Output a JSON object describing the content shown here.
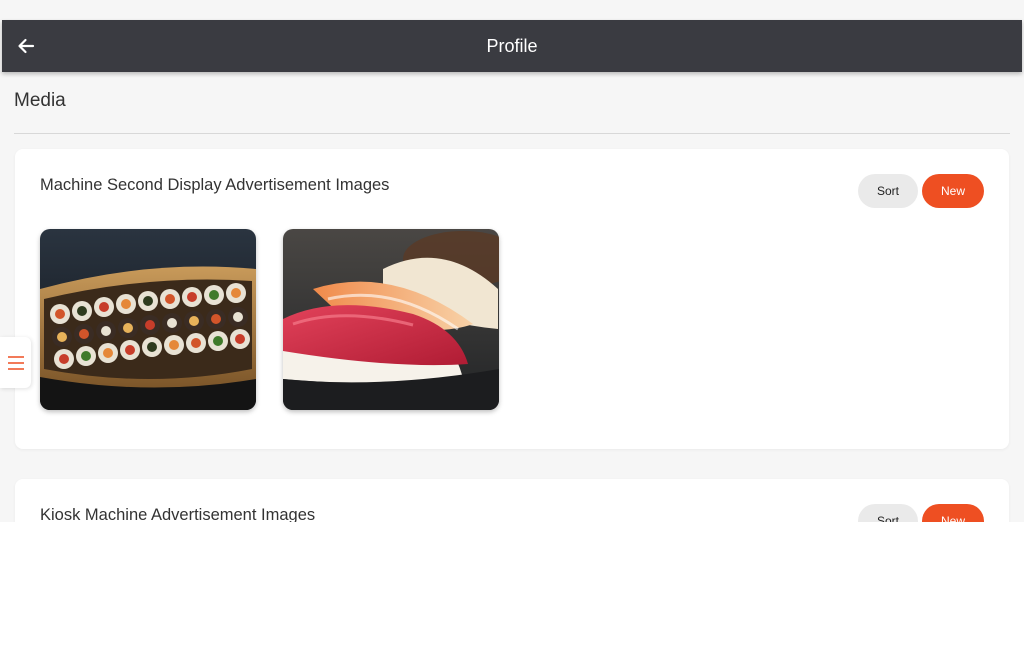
{
  "header": {
    "title": "Profile",
    "back_icon": "arrow-left-icon"
  },
  "section": {
    "heading": "Media"
  },
  "cards": [
    {
      "title": "Machine Second Display Advertisement Images",
      "sort_label": "Sort",
      "new_label": "New",
      "images": [
        "sushi-boat-image",
        "nigiri-sushi-image"
      ]
    },
    {
      "title": "Kiosk Machine Advertisement Images",
      "sort_label": "Sort",
      "new_label": "New"
    }
  ],
  "drawer": {
    "icon": "hamburger-menu-icon"
  },
  "colors": {
    "appbar": "#3a3b41",
    "accent": "#ee4f22",
    "background": "#f6f6f6",
    "card": "#ffffff"
  }
}
